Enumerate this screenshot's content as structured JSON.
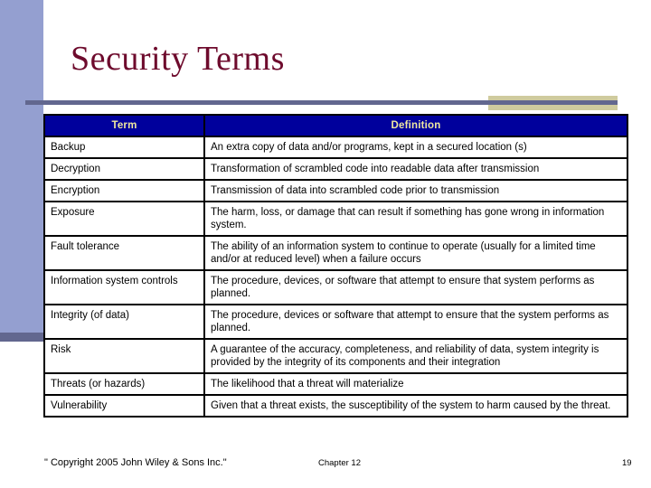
{
  "slide": {
    "title": "Security Terms",
    "colors": {
      "title_text": "#6e0b2d",
      "left_band": "#949fd0",
      "left_band_foot": "#62678f",
      "title_rule": "#62678f",
      "accent_block": "#cfcb9e",
      "table_header_bg": "#00009c",
      "table_header_text": "#efe8a0",
      "table_border": "#000000",
      "background": "#ffffff"
    }
  },
  "table": {
    "columns": [
      "Term",
      "Definition"
    ],
    "rows": [
      {
        "term": "Backup",
        "definition": "An extra copy of data and/or programs, kept in a secured location (s)"
      },
      {
        "term": "Decryption",
        "definition": "Transformation of scrambled code into readable data after transmission"
      },
      {
        "term": "Encryption",
        "definition": "Transmission of data into scrambled code prior to transmission"
      },
      {
        "term": "Exposure",
        "definition": "The harm, loss, or damage that can result if something has gone wrong in information system."
      },
      {
        "term": "Fault tolerance",
        "definition": "The ability of an information system to continue to operate (usually for a limited time and/or at reduced level) when a failure occurs"
      },
      {
        "term": "Information system controls",
        "definition": "The procedure, devices, or software that attempt to ensure that system performs as planned."
      },
      {
        "term": "Integrity (of data)",
        "definition": "The procedure, devices or software that attempt to ensure that the system performs as planned."
      },
      {
        "term": "Risk",
        "definition": "A guarantee of the accuracy, completeness, and reliability of data, system integrity is provided by the integrity of its components and their integration"
      },
      {
        "term": "Threats (or hazards)",
        "definition": "The likelihood that a threat will materialize"
      },
      {
        "term": "Vulnerability",
        "definition": "Given that a threat exists, the susceptibility of the system to harm caused by the threat."
      }
    ]
  },
  "footer": {
    "copyright": "\" Copyright 2005 John Wiley & Sons Inc.\"",
    "chapter": "Chapter 12",
    "page_number": "19"
  }
}
